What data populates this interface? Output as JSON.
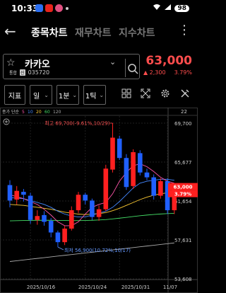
{
  "status": {
    "time": "10:33",
    "battery": "98"
  },
  "nav": {
    "tabs": [
      "종목차트",
      "재무차트",
      "지수차트"
    ]
  },
  "stock": {
    "name": "카카오",
    "tag_a": "통합",
    "tag_b": "신",
    "code": "035720",
    "price": "63,000",
    "change": "▲ 2,300",
    "change_pct": "3.79%"
  },
  "toolbar": {
    "indicator": "지표",
    "period": "일",
    "minute": "1분",
    "tick": "1틱"
  },
  "legend": {
    "label": "종가 단순",
    "periods": [
      "5",
      "10",
      "20",
      "60",
      "120"
    ]
  },
  "annotations": {
    "high": "최고 69,700(-9.61%,10/29)",
    "low": "최저 56,900(10.72%,10/17)"
  },
  "colors": {
    "up": "#ff2020",
    "down": "#2060ff",
    "ma5": "#ff55aa",
    "ma10": "#4488ff",
    "ma20": "#ffcc33",
    "ma60": "#44dd66",
    "ma120": "#aaaaaa"
  },
  "chart_data": {
    "type": "candlestick",
    "y_ticks": [
      "69,700",
      "65,677",
      "61,654",
      "57,631",
      "53,608"
    ],
    "x_ticks": [
      "2025/10/16",
      "2025/10/24",
      "2025/10/31",
      "11/07"
    ],
    "top_right_label": "22",
    "price_label": "63,000",
    "price_pct_label": "3.79%",
    "ylim": [
      53608,
      69700
    ],
    "candles": [
      {
        "o": 63300,
        "c": 61700,
        "h": 63800,
        "l": 61000
      },
      {
        "o": 61800,
        "c": 62700,
        "h": 63200,
        "l": 61300
      },
      {
        "o": 62600,
        "c": 62300,
        "h": 62900,
        "l": 61600
      },
      {
        "o": 62200,
        "c": 59700,
        "h": 62500,
        "l": 59300
      },
      {
        "o": 59700,
        "c": 60100,
        "h": 60700,
        "l": 59200
      },
      {
        "o": 60200,
        "c": 59500,
        "h": 60600,
        "l": 59100
      },
      {
        "o": 59600,
        "c": 58400,
        "h": 59900,
        "l": 57900
      },
      {
        "o": 58400,
        "c": 57400,
        "h": 58600,
        "l": 56900
      },
      {
        "o": 57400,
        "c": 58800,
        "h": 59100,
        "l": 57100
      },
      {
        "o": 58800,
        "c": 60700,
        "h": 61100,
        "l": 58600
      },
      {
        "o": 60700,
        "c": 62300,
        "h": 62600,
        "l": 60400
      },
      {
        "o": 62300,
        "c": 61700,
        "h": 62500,
        "l": 61300
      },
      {
        "o": 61700,
        "c": 60000,
        "h": 61900,
        "l": 59700
      },
      {
        "o": 60000,
        "c": 60800,
        "h": 61200,
        "l": 59600
      },
      {
        "o": 60800,
        "c": 65000,
        "h": 65400,
        "l": 60600
      },
      {
        "o": 64900,
        "c": 68200,
        "h": 69700,
        "l": 64600
      },
      {
        "o": 68100,
        "c": 66100,
        "h": 68400,
        "l": 65900
      },
      {
        "o": 66100,
        "c": 63100,
        "h": 66500,
        "l": 62800
      },
      {
        "o": 63200,
        "c": 66700,
        "h": 67000,
        "l": 62900
      },
      {
        "o": 66600,
        "c": 64600,
        "h": 66900,
        "l": 64300
      },
      {
        "o": 64600,
        "c": 64100,
        "h": 65000,
        "l": 63800
      },
      {
        "o": 64100,
        "c": 62200,
        "h": 64400,
        "l": 61800
      },
      {
        "o": 62200,
        "c": 63700,
        "h": 64000,
        "l": 61900
      },
      {
        "o": 63700,
        "c": 60700,
        "h": 64000,
        "l": 60300
      },
      {
        "o": 60700,
        "c": 63000,
        "h": 63300,
        "l": 60300
      }
    ],
    "ma5": [
      62300,
      62100,
      61900,
      61600,
      61300,
      60800,
      60200,
      59500,
      59100,
      59100,
      59500,
      60300,
      61000,
      61300,
      61500,
      62400,
      63700,
      64600,
      65300,
      65500,
      65200,
      64700,
      64100,
      63700,
      63500
    ],
    "ma10": [
      62000,
      61950,
      61900,
      61700,
      61500,
      61300,
      61000,
      60600,
      60300,
      60100,
      60000,
      60000,
      60200,
      60400,
      60600,
      61000,
      61600,
      62300,
      63000,
      63500,
      63700,
      63800,
      63900,
      63900,
      63800
    ],
    "ma20": [
      61300,
      61250,
      61200,
      61100,
      61000,
      60900,
      60800,
      60650,
      60500,
      60400,
      60300,
      60250,
      60300,
      60350,
      60450,
      60650,
      60900,
      61200,
      61500,
      61800,
      62050,
      62250,
      62400,
      62500,
      62550
    ],
    "ma60": [
      59600,
      59620,
      59640,
      59650,
      59660,
      59660,
      59660,
      59650,
      59640,
      59630,
      59630,
      59640,
      59660,
      59690,
      59730,
      59800,
      59880,
      59960,
      60050,
      60130,
      60200,
      60260,
      60310,
      60350,
      60380
    ],
    "ma120": [
      55400,
      55480,
      55560,
      55640,
      55720,
      55800,
      55880,
      55960,
      56040,
      56120,
      56200,
      56280,
      56360,
      56440,
      56520,
      56600,
      56680,
      56760,
      56840,
      56920,
      57000,
      57080,
      57160,
      57240,
      57320
    ]
  }
}
